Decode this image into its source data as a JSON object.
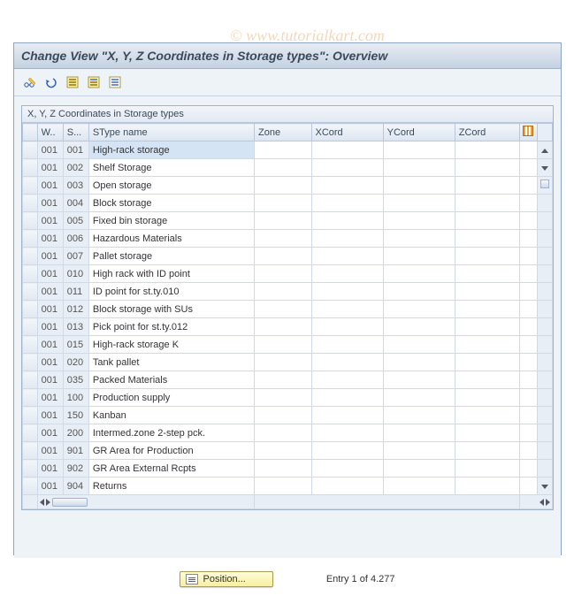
{
  "watermark": "© www.tutorialkart.com",
  "title": "Change View \"X, Y, Z Coordinates in Storage types\": Overview",
  "toolbar": {
    "change": "Change",
    "undo": "Undo",
    "select_all": "Select All",
    "deselect": "Deselect All",
    "config": "Table Settings"
  },
  "table": {
    "caption": "X, Y, Z Coordinates in Storage types",
    "columns": {
      "sel": "",
      "whn": "W..",
      "sty": "S...",
      "name": "SType name",
      "zone": "Zone",
      "xcord": "XCord",
      "ycord": "YCord",
      "zcord": "ZCord"
    },
    "rows": [
      {
        "w": "001",
        "s": "001",
        "name": "High-rack storage",
        "zone": "",
        "x": "",
        "y": "",
        "z": "",
        "hl": true
      },
      {
        "w": "001",
        "s": "002",
        "name": "Shelf Storage",
        "zone": "",
        "x": "",
        "y": "",
        "z": ""
      },
      {
        "w": "001",
        "s": "003",
        "name": "Open storage",
        "zone": "",
        "x": "",
        "y": "",
        "z": ""
      },
      {
        "w": "001",
        "s": "004",
        "name": "Block storage",
        "zone": "",
        "x": "",
        "y": "",
        "z": ""
      },
      {
        "w": "001",
        "s": "005",
        "name": "Fixed bin storage",
        "zone": "",
        "x": "",
        "y": "",
        "z": ""
      },
      {
        "w": "001",
        "s": "006",
        "name": "Hazardous Materials",
        "zone": "",
        "x": "",
        "y": "",
        "z": ""
      },
      {
        "w": "001",
        "s": "007",
        "name": "Pallet storage",
        "zone": "",
        "x": "",
        "y": "",
        "z": ""
      },
      {
        "w": "001",
        "s": "010",
        "name": "High rack with ID point",
        "zone": "",
        "x": "",
        "y": "",
        "z": ""
      },
      {
        "w": "001",
        "s": "011",
        "name": "ID point for st.ty.010",
        "zone": "",
        "x": "",
        "y": "",
        "z": ""
      },
      {
        "w": "001",
        "s": "012",
        "name": "Block storage with SUs",
        "zone": "",
        "x": "",
        "y": "",
        "z": ""
      },
      {
        "w": "001",
        "s": "013",
        "name": "Pick point for st.ty.012",
        "zone": "",
        "x": "",
        "y": "",
        "z": ""
      },
      {
        "w": "001",
        "s": "015",
        "name": "High-rack storage K",
        "zone": "",
        "x": "",
        "y": "",
        "z": ""
      },
      {
        "w": "001",
        "s": "020",
        "name": "Tank pallet",
        "zone": "",
        "x": "",
        "y": "",
        "z": ""
      },
      {
        "w": "001",
        "s": "035",
        "name": "Packed Materials",
        "zone": "",
        "x": "",
        "y": "",
        "z": ""
      },
      {
        "w": "001",
        "s": "100",
        "name": "Production supply",
        "zone": "",
        "x": "",
        "y": "",
        "z": ""
      },
      {
        "w": "001",
        "s": "150",
        "name": "Kanban",
        "zone": "",
        "x": "",
        "y": "",
        "z": ""
      },
      {
        "w": "001",
        "s": "200",
        "name": "Intermed.zone 2-step pck.",
        "zone": "",
        "x": "",
        "y": "",
        "z": ""
      },
      {
        "w": "001",
        "s": "901",
        "name": "GR Area for Production",
        "zone": "",
        "x": "",
        "y": "",
        "z": ""
      },
      {
        "w": "001",
        "s": "902",
        "name": "GR Area External Rcpts",
        "zone": "",
        "x": "",
        "y": "",
        "z": ""
      },
      {
        "w": "001",
        "s": "904",
        "name": "Returns",
        "zone": "",
        "x": "",
        "y": "",
        "z": ""
      }
    ]
  },
  "footer": {
    "position_label": "Position...",
    "entry_status": "Entry 1 of 4.277"
  }
}
